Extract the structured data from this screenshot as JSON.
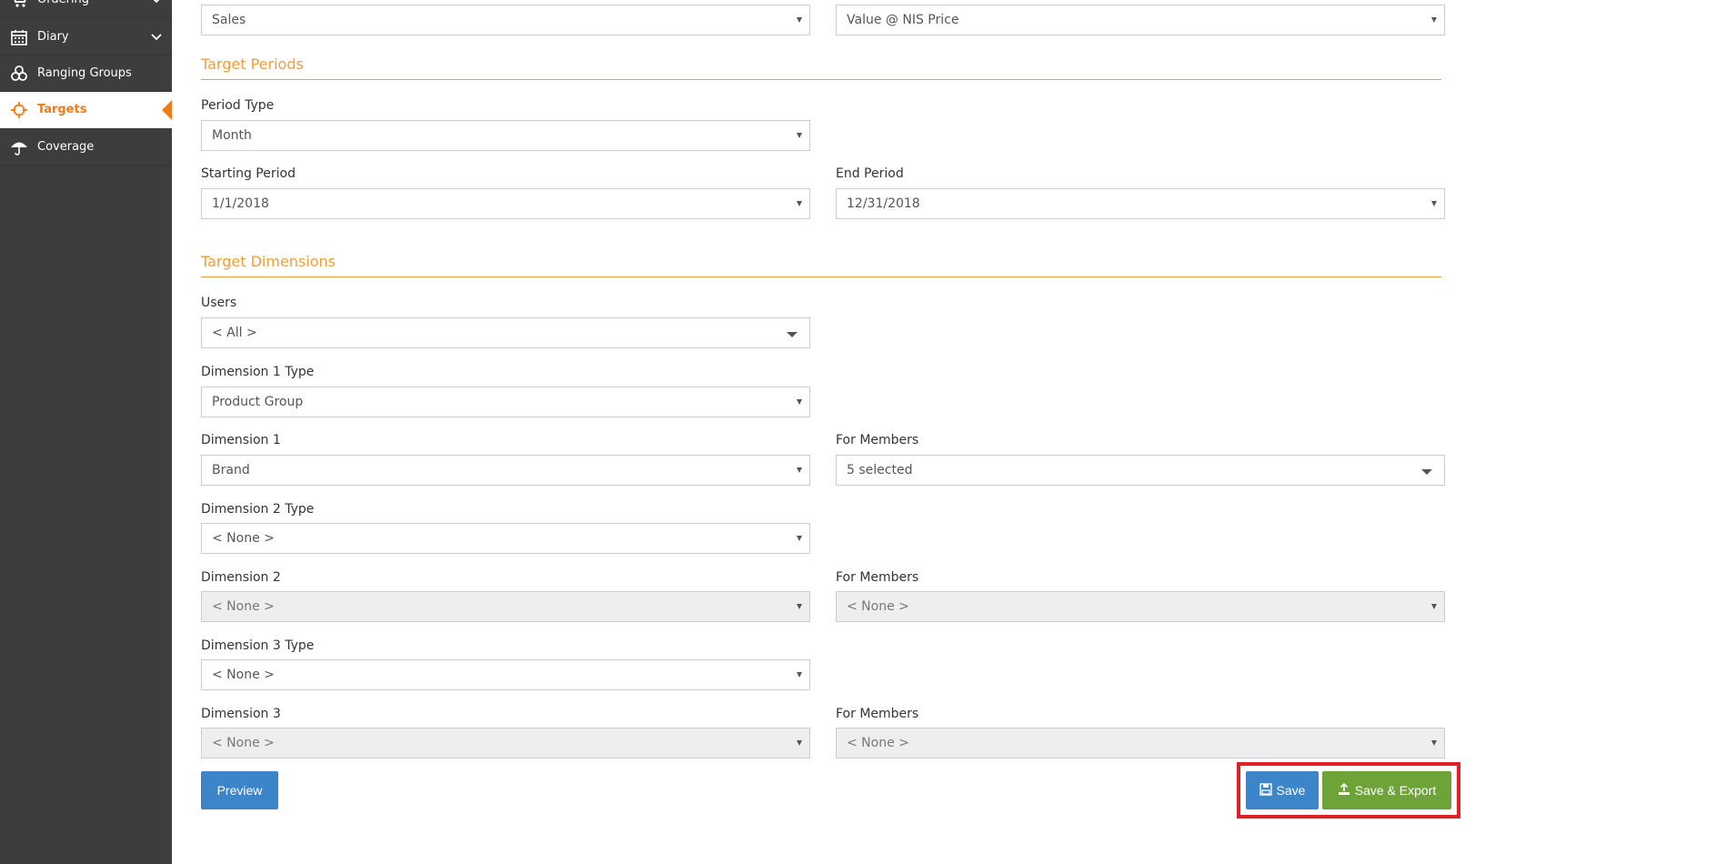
{
  "sidebar": {
    "items": [
      {
        "label": "Ordering",
        "icon": "cart-icon"
      },
      {
        "label": "Diary",
        "icon": "calendar-icon"
      },
      {
        "label": "Ranging Groups",
        "icon": "boxes-icon"
      },
      {
        "label": "Targets",
        "icon": "crosshair-icon",
        "active": true
      },
      {
        "label": "Coverage",
        "icon": "umbrella-icon"
      }
    ]
  },
  "top_fields": {
    "measure_value": "Sales",
    "value_type_value": "Value @ NIS Price"
  },
  "target_periods": {
    "title": "Target Periods",
    "period_type_label": "Period Type",
    "period_type_value": "Month",
    "starting_period_label": "Starting Period",
    "starting_period_value": "1/1/2018",
    "end_period_label": "End Period",
    "end_period_value": "12/31/2018"
  },
  "target_dimensions": {
    "title": "Target Dimensions",
    "users_label": "Users",
    "users_value": "< All >",
    "dim1_type_label": "Dimension 1 Type",
    "dim1_type_value": "Product Group",
    "dim1_label": "Dimension 1",
    "dim1_value": "Brand",
    "dim1_members_label": "For Members",
    "dim1_members_value": "5 selected",
    "dim2_type_label": "Dimension 2 Type",
    "dim2_type_value": "< None >",
    "dim2_label": "Dimension 2",
    "dim2_value": "< None >",
    "dim2_members_label": "For Members",
    "dim2_members_value": "< None >",
    "dim3_type_label": "Dimension 3 Type",
    "dim3_type_value": "< None >",
    "dim3_label": "Dimension 3",
    "dim3_value": "< None >",
    "dim3_members_label": "For Members",
    "dim3_members_value": "< None >"
  },
  "actions": {
    "preview_label": "Preview",
    "save_label": "Save",
    "save_export_label": "Save & Export"
  },
  "colors": {
    "accent": "#f07b1a",
    "sidebar_bg": "#3d3d3d",
    "primary_button": "#3c85c8",
    "success_button": "#6ea33a",
    "highlight": "#e01f26"
  }
}
